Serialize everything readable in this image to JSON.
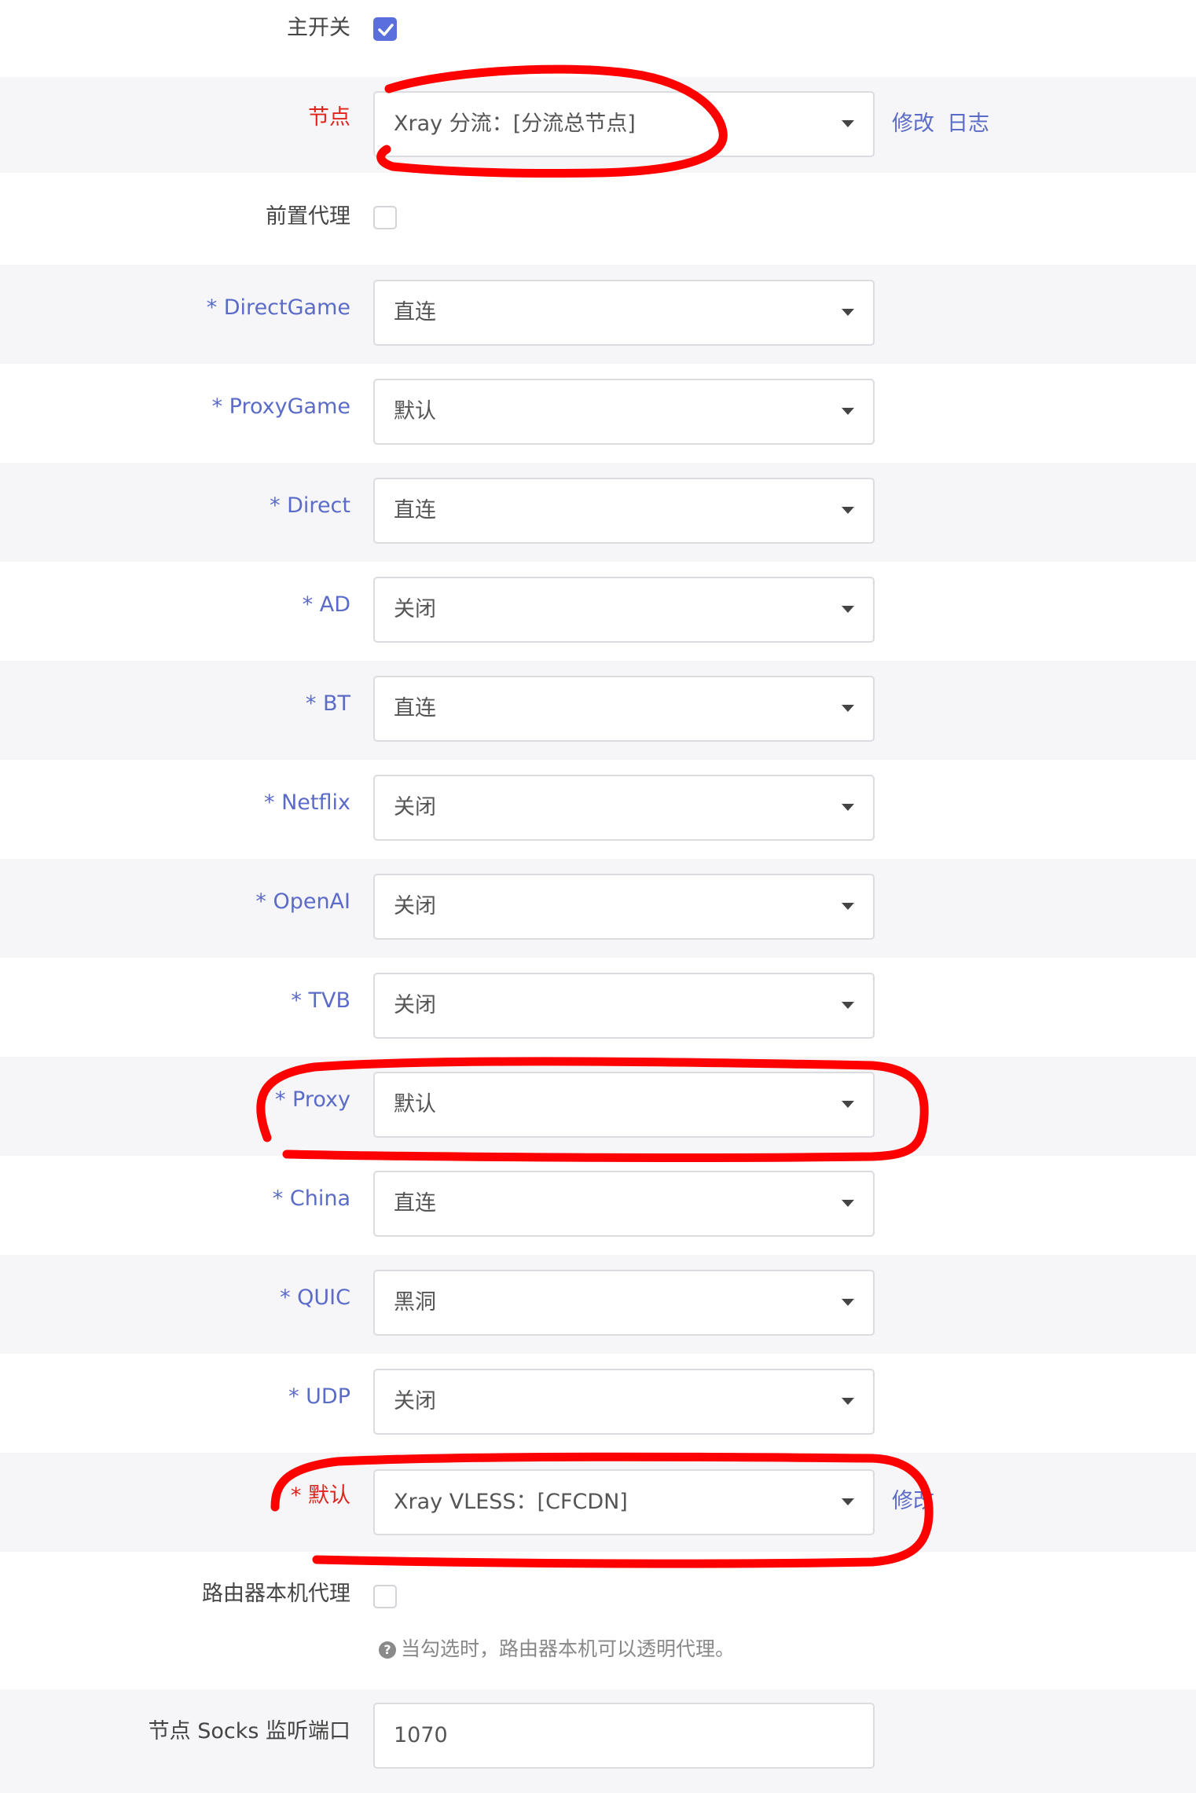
{
  "main_switch": {
    "label": "主开关",
    "checked": true
  },
  "node": {
    "label": "节点",
    "value": "Xray 分流：[分流总节点]",
    "edit_label": "修改",
    "log_label": "日志"
  },
  "pre_proxy": {
    "label": "前置代理",
    "checked": false
  },
  "rules": [
    {
      "label": "* DirectGame",
      "value": "直连"
    },
    {
      "label": "* ProxyGame",
      "value": "默认"
    },
    {
      "label": "* Direct",
      "value": "直连"
    },
    {
      "label": "* AD",
      "value": "关闭"
    },
    {
      "label": "* BT",
      "value": "直连"
    },
    {
      "label": "* Netflix",
      "value": "关闭"
    },
    {
      "label": "* OpenAI",
      "value": "关闭"
    },
    {
      "label": "* TVB",
      "value": "关闭"
    },
    {
      "label": "* Proxy",
      "value": "默认"
    },
    {
      "label": "* China",
      "value": "直连"
    },
    {
      "label": "* QUIC",
      "value": "黑洞"
    },
    {
      "label": "* UDP",
      "value": "关闭"
    }
  ],
  "default_rule": {
    "label": "* 默认",
    "value": "Xray VLESS：[CFCDN]",
    "edit_label": "修改"
  },
  "router_proxy": {
    "label": "路由器本机代理",
    "checked": false,
    "hint": "当勾选时，路由器本机可以透明代理。"
  },
  "socks_port": {
    "label": "节点 Socks 监听端口",
    "value": "1070"
  },
  "colors": {
    "accent": "#5a6fdc",
    "link": "#5b6bc8",
    "required": "#e0231d",
    "annotation": "#ff0000"
  }
}
